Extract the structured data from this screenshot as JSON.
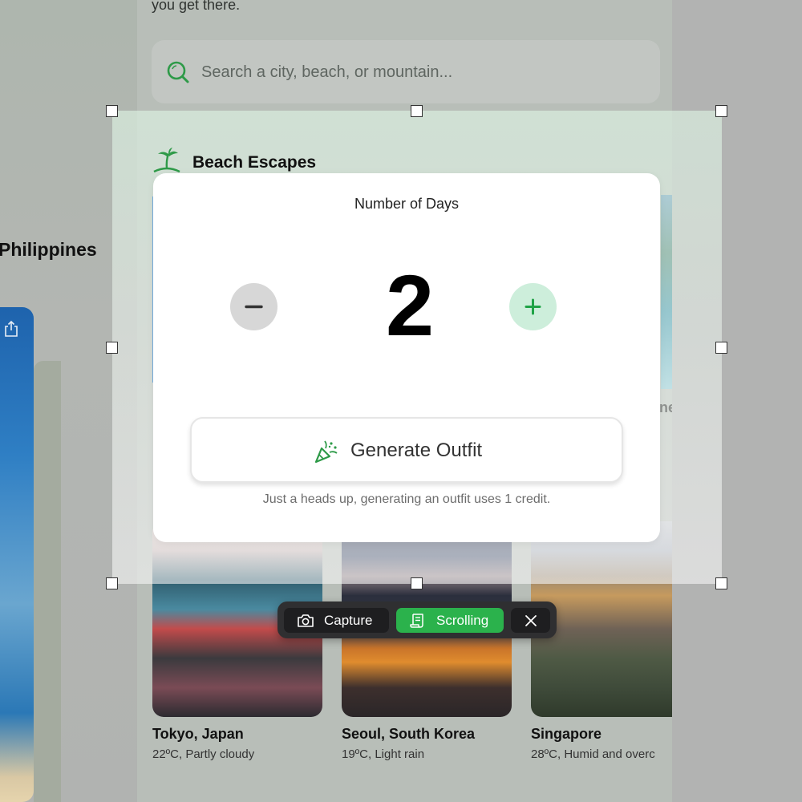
{
  "app": {
    "intro_text": "you get there.",
    "search": {
      "placeholder": "Search a city, beach, or mountain..."
    },
    "country_title": "Philippines",
    "section_title": "Beach Escapes",
    "right_peek_text": "ne",
    "cities": [
      {
        "name": "Tokyo, Japan",
        "weather": "22ºC, Partly cloudy"
      },
      {
        "name": "Seoul, South Korea",
        "weather": "19ºC, Light rain"
      },
      {
        "name": "Singapore",
        "weather": "28ºC, Humid and overc"
      }
    ]
  },
  "modal": {
    "label": "Number of Days",
    "days": "2",
    "generate_label": "Generate Outfit",
    "credit_note": "Just a heads up, generating an outfit uses 1 credit."
  },
  "toolbar": {
    "capture_label": "Capture",
    "scrolling_label": "Scrolling"
  },
  "colors": {
    "accent_green": "#2bb24c",
    "plus_button_bg": "#cdeedb",
    "toolbar_bg": "#2f2f31"
  },
  "icons": [
    "search-icon",
    "share-icon",
    "palm-tree-icon",
    "minus-icon",
    "plus-icon",
    "party-popper-icon",
    "camera-icon",
    "scroll-icon",
    "close-icon"
  ]
}
